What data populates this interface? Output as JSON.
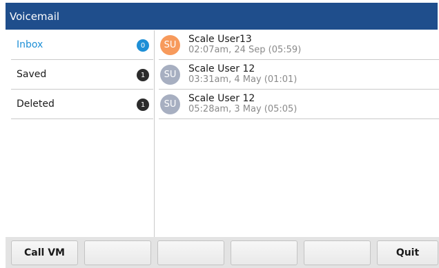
{
  "header": {
    "title": "Voicemail"
  },
  "folders": [
    {
      "label": "Inbox",
      "count": "0"
    },
    {
      "label": "Saved",
      "count": "1"
    },
    {
      "label": "Deleted",
      "count": "1"
    }
  ],
  "messages": [
    {
      "initials": "SU",
      "name": "Scale User13",
      "time": "02:07am, 24 Sep (05:59)",
      "avatar_color": "#f79a5c"
    },
    {
      "initials": "SU",
      "name": "Scale User 12",
      "time": "03:31am, 4 May (01:01)",
      "avatar_color": "#a7afc1"
    },
    {
      "initials": "SU",
      "name": "Scale User 12",
      "time": "05:28am, 3 May (05:05)",
      "avatar_color": "#a7afc1"
    }
  ],
  "softkeys": [
    "Call VM",
    "",
    "",
    "",
    "",
    "Quit"
  ],
  "colors": {
    "header_bg": "#1f4e8c",
    "active_folder": "#1e8fd6",
    "badge_dark": "#2b2b2b",
    "softkey_bar": "#e3e3e3"
  }
}
